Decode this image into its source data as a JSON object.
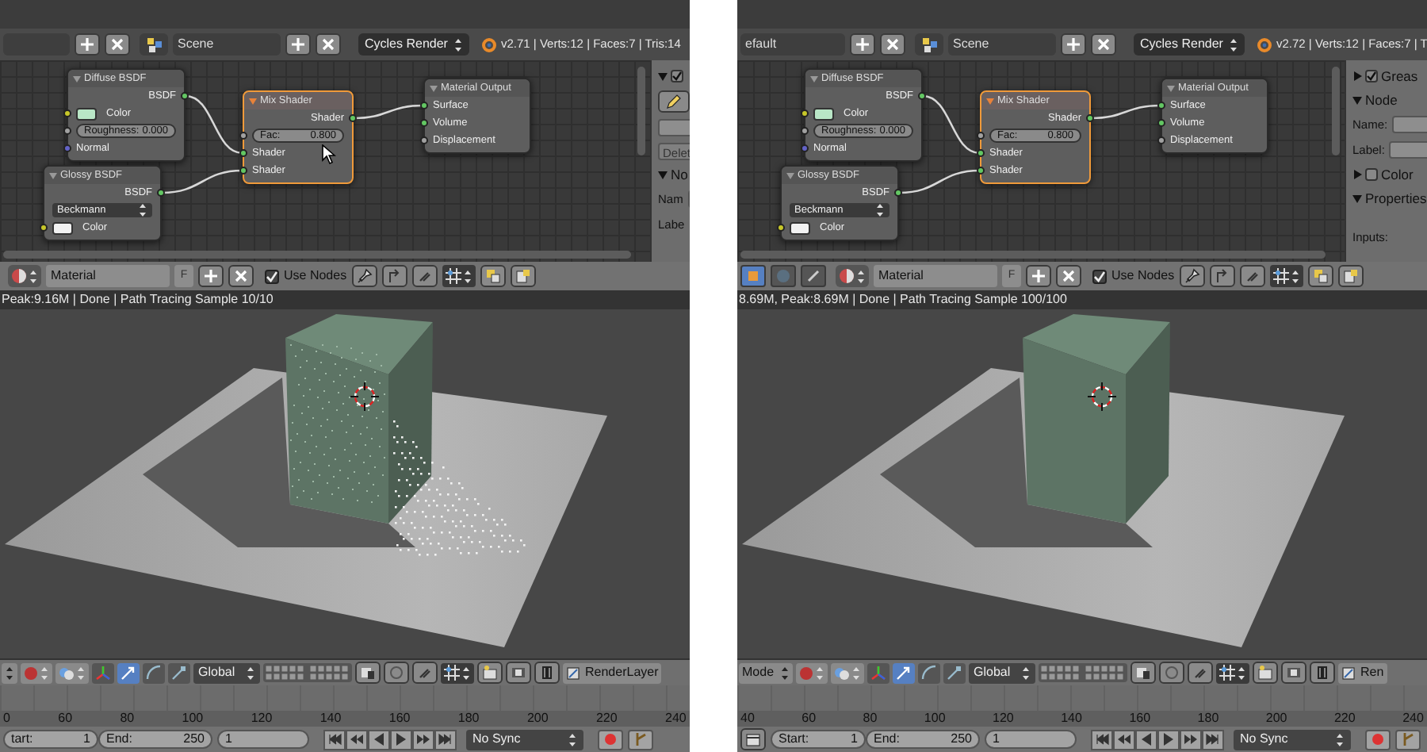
{
  "panels": [
    {
      "header": {
        "scene": "Scene",
        "engine": "Cycles Render",
        "stats": "v2.71 | Verts:12 | Faces:7 | Tris:14"
      },
      "nodes": [
        {
          "title": "Diffuse BSDF",
          "selected": false,
          "rows": [
            {
              "kind": "output",
              "label": "BSDF",
              "socket": {
                "color": "#63c763"
              }
            },
            {
              "kind": "color",
              "label": "Color",
              "socket": {
                "color": "#c7c729"
              },
              "color": "#b9e6c6"
            },
            {
              "kind": "value",
              "label": "Roughness:",
              "value": "0.000",
              "socket": {
                "color": "#a1a1a1"
              }
            },
            {
              "kind": "input",
              "label": "Normal",
              "socket": {
                "color": "#6363c7"
              }
            }
          ]
        },
        {
          "title": "Mix Shader",
          "selected": true,
          "rows": [
            {
              "kind": "output",
              "label": "Shader",
              "socket": {
                "color": "#63c763"
              }
            },
            {
              "kind": "value",
              "label": "Fac:",
              "value": "0.800",
              "socket": {
                "color": "#a1a1a1"
              }
            },
            {
              "kind": "input",
              "label": "Shader",
              "socket": {
                "color": "#63c763"
              }
            },
            {
              "kind": "input",
              "label": "Shader",
              "socket": {
                "color": "#63c763"
              }
            }
          ]
        },
        {
          "title": "Material Output",
          "selected": false,
          "rows": [
            {
              "kind": "input",
              "label": "Surface",
              "socket": {
                "color": "#63c763"
              }
            },
            {
              "kind": "input",
              "label": "Volume",
              "socket": {
                "color": "#63c763"
              }
            },
            {
              "kind": "input",
              "label": "Displacement",
              "socket": {
                "color": "#a1a1a1"
              }
            }
          ]
        },
        {
          "title": "Glossy BSDF",
          "selected": false,
          "rows": [
            {
              "kind": "output",
              "label": "BSDF",
              "socket": {
                "color": "#63c763"
              }
            },
            {
              "kind": "dropdown",
              "label": "Beckmann"
            },
            {
              "kind": "color",
              "label": "Color",
              "socket": {
                "color": "#c7c729"
              },
              "color": "#f2f2f2"
            }
          ]
        }
      ],
      "cursor": true,
      "sidebar": [
        {
          "kind": "panel",
          "expanded": true,
          "checked": true
        },
        {
          "kind": "tool"
        },
        {
          "kind": "field"
        },
        {
          "kind": "button",
          "label": "Delet"
        },
        {
          "kind": "panel",
          "expanded": true,
          "label": "No"
        },
        {
          "kind": "field",
          "label": "Nam"
        },
        {
          "kind": "field",
          "label": "Labe"
        }
      ],
      "node_header": {
        "material": "Material",
        "fake_user": "F",
        "use_nodes": {
          "label": "Use Nodes",
          "checked": true
        }
      },
      "status": "Peak:9.16M | Done | Path Tracing Sample 10/10",
      "noisy": true,
      "view3d_header": {
        "orientation": "Global",
        "render_layer": "RenderLayer"
      },
      "timeline": {
        "leading_icon": false,
        "ticks": [
          "0",
          "60",
          "80",
          "100",
          "120",
          "140",
          "160",
          "180",
          "200",
          "220",
          "240"
        ],
        "start": {
          "label": "tart:",
          "value": "1"
        },
        "end": {
          "label": "End:",
          "value": "250"
        },
        "current": "1",
        "sync": "No Sync"
      }
    },
    {
      "header": {
        "layout": "efault",
        "scene": "Scene",
        "engine": "Cycles Render",
        "stats": "v2.72 | Verts:12 | Faces:7 | T"
      },
      "nodes": [
        {
          "title": "Diffuse BSDF",
          "selected": false,
          "rows": [
            {
              "kind": "output",
              "label": "BSDF",
              "socket": {
                "color": "#63c763"
              }
            },
            {
              "kind": "color",
              "label": "Color",
              "socket": {
                "color": "#c7c729"
              },
              "color": "#b9e6c6"
            },
            {
              "kind": "value",
              "label": "Roughness:",
              "value": "0.000",
              "socket": {
                "color": "#a1a1a1"
              }
            },
            {
              "kind": "input",
              "label": "Normal",
              "socket": {
                "color": "#6363c7"
              }
            }
          ]
        },
        {
          "title": "Mix Shader",
          "selected": true,
          "rows": [
            {
              "kind": "output",
              "label": "Shader",
              "socket": {
                "color": "#63c763"
              }
            },
            {
              "kind": "value",
              "label": "Fac:",
              "value": "0.800",
              "socket": {
                "color": "#a1a1a1"
              }
            },
            {
              "kind": "input",
              "label": "Shader",
              "socket": {
                "color": "#63c763"
              }
            },
            {
              "kind": "input",
              "label": "Shader",
              "socket": {
                "color": "#63c763"
              }
            }
          ]
        },
        {
          "title": "Material Output",
          "selected": false,
          "rows": [
            {
              "kind": "input",
              "label": "Surface",
              "socket": {
                "color": "#63c763"
              }
            },
            {
              "kind": "input",
              "label": "Volume",
              "socket": {
                "color": "#63c763"
              }
            },
            {
              "kind": "input",
              "label": "Displacement",
              "socket": {
                "color": "#a1a1a1"
              }
            }
          ]
        },
        {
          "title": "Glossy BSDF",
          "selected": false,
          "rows": [
            {
              "kind": "output",
              "label": "BSDF",
              "socket": {
                "color": "#63c763"
              }
            },
            {
              "kind": "dropdown",
              "label": "Beckmann"
            },
            {
              "kind": "color",
              "label": "Color",
              "socket": {
                "color": "#c7c729"
              },
              "color": "#f2f2f2"
            }
          ]
        }
      ],
      "cursor": false,
      "sidebar": [
        {
          "kind": "panel",
          "expanded": false,
          "checked": true,
          "label": "Greas"
        },
        {
          "kind": "panel",
          "expanded": true,
          "label": "Node"
        },
        {
          "kind": "field",
          "label": "Name:"
        },
        {
          "kind": "field",
          "label": "Label:"
        },
        {
          "kind": "panel",
          "expanded": false,
          "checked": false,
          "label": "Color"
        },
        {
          "kind": "panel",
          "expanded": true,
          "label": "Properties"
        },
        {
          "kind": "text",
          "label": "Inputs:"
        }
      ],
      "node_header": {
        "tree_types": [
          {
            "selected": true
          },
          {
            "selected": false
          },
          {
            "selected": false
          }
        ],
        "material": "Material",
        "fake_user": "F",
        "use_nodes": {
          "label": "Use Nodes",
          "checked": true
        }
      },
      "status": "8.69M, Peak:8.69M | Done | Path Tracing Sample 100/100",
      "noisy": false,
      "view3d_header": {
        "mode": "Mode",
        "orientation": "Global",
        "render_layer": "Ren"
      },
      "timeline": {
        "leading_icon": true,
        "ticks": [
          "40",
          "60",
          "80",
          "100",
          "120",
          "140",
          "160",
          "180",
          "200",
          "220",
          "240"
        ],
        "start": {
          "label": "Start:",
          "value": "1"
        },
        "end": {
          "label": "End:",
          "value": "250"
        },
        "current": "1",
        "sync": "No Sync"
      }
    }
  ]
}
